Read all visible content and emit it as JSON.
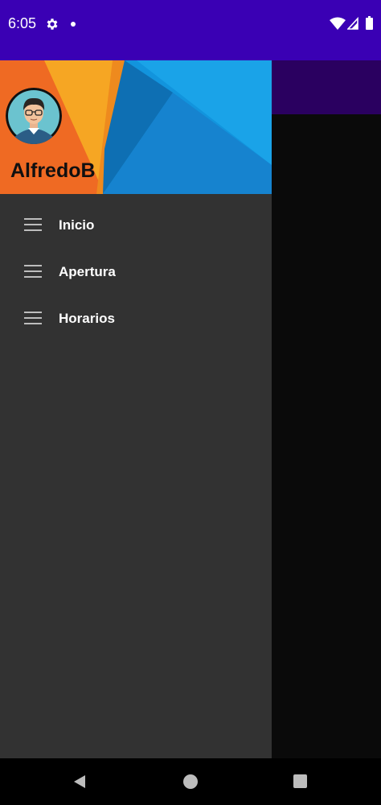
{
  "status_bar": {
    "time": "6:05",
    "icons": [
      "gear-icon",
      "notification-dot-icon",
      "wifi-icon",
      "signal-icon",
      "battery-icon"
    ],
    "background": "#3a00b4"
  },
  "drawer": {
    "header": {
      "user_name": "AlfredoB",
      "avatar": "user-avatar-icon"
    },
    "items": [
      {
        "label": "Inicio",
        "icon": "menu-lines-icon"
      },
      {
        "label": "Apertura",
        "icon": "menu-lines-icon"
      },
      {
        "label": "Horarios",
        "icon": "menu-lines-icon"
      }
    ],
    "background": "#323232"
  },
  "app": {
    "toolbar_color": "#2a0060"
  },
  "nav_bar": {
    "icons": [
      "back-icon",
      "home-icon",
      "recents-icon"
    ]
  }
}
